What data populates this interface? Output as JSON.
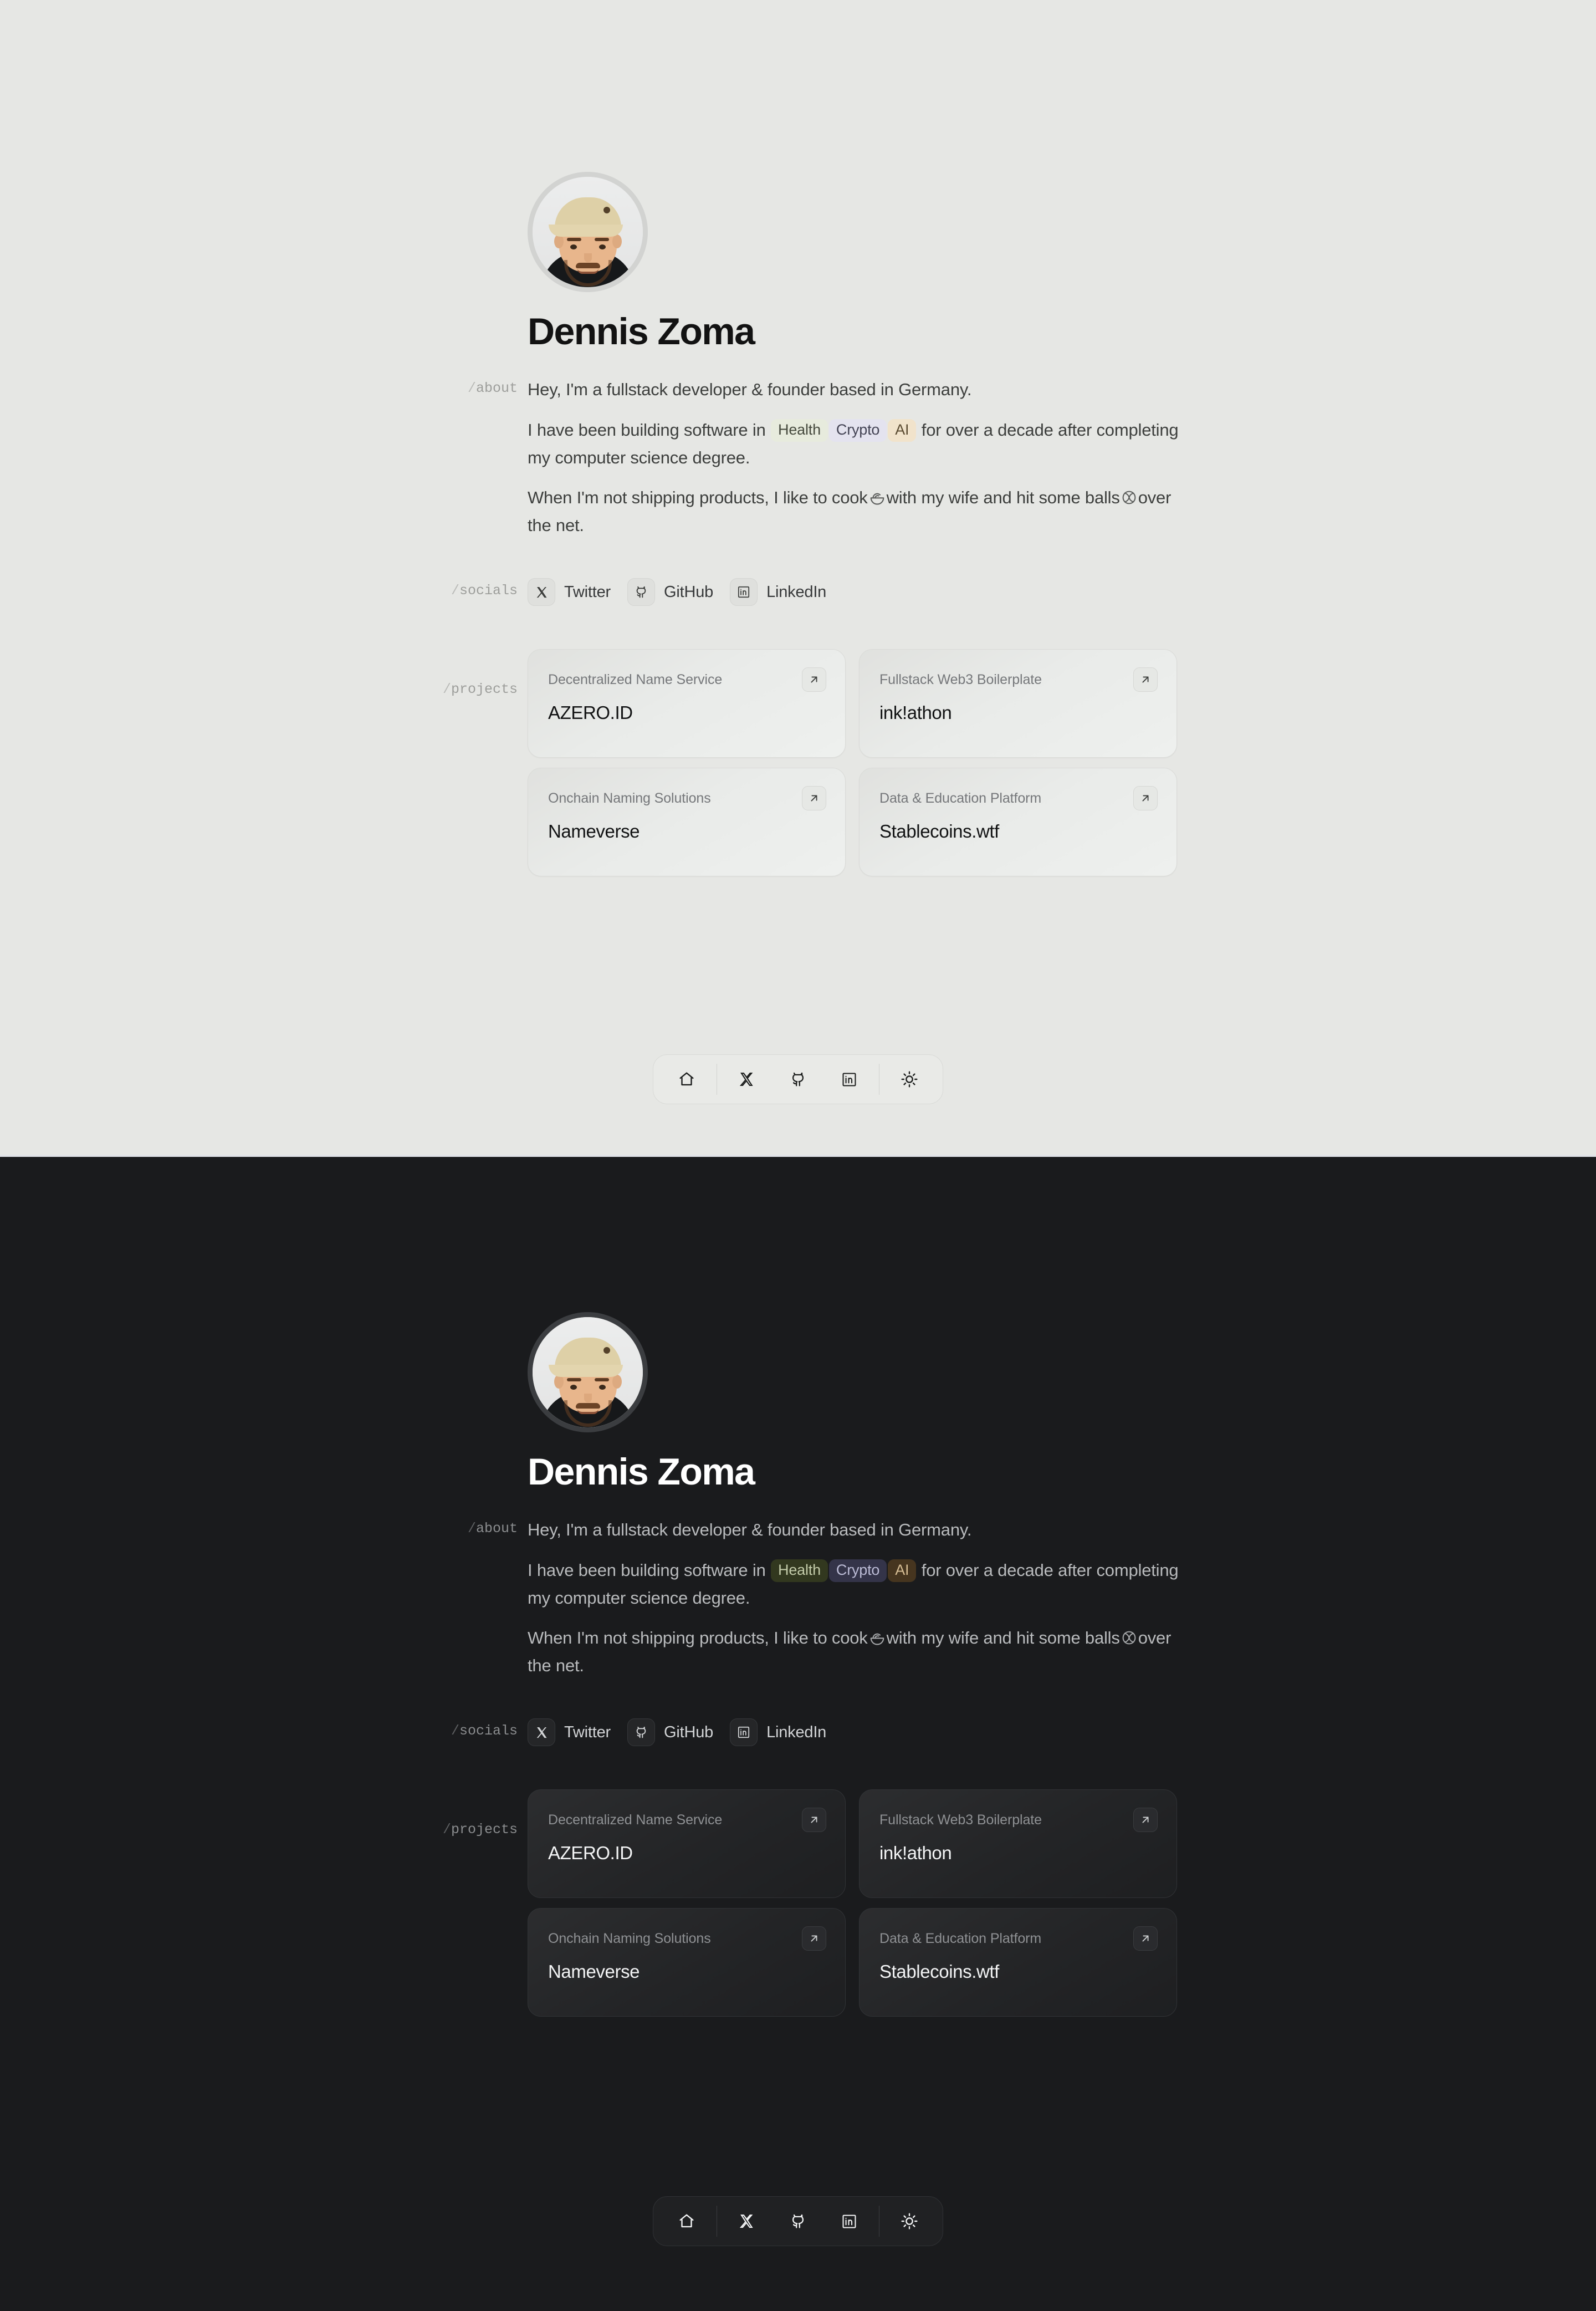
{
  "profile": {
    "name": "Dennis Zoma",
    "avatar_alt": "portrait-photo"
  },
  "sections": {
    "about_label": "/about",
    "socials_label": "/socials",
    "projects_label": "/projects"
  },
  "about": {
    "line1": "Hey, I'm a fullstack developer & founder based in Germany.",
    "p2_before": "I have been building software in",
    "p2_after": "for over a decade after completing my computer science degree.",
    "tags": [
      {
        "label": "Health",
        "key": "health",
        "color": "#e7ebdd"
      },
      {
        "label": "Crypto",
        "key": "crypto",
        "color": "#e4e3ef"
      },
      {
        "label": "AI",
        "key": "ai",
        "color": "#f1e3cb"
      }
    ],
    "p3_before": "When I'm not shipping products, I like to cook",
    "p3_middle": "with my wife and hit some balls",
    "p3_after": "over the net.",
    "cook_icon": "bowl-icon",
    "tennis_icon": "tennis-ball-icon"
  },
  "socials": [
    {
      "name": "Twitter",
      "icon": "x-icon"
    },
    {
      "name": "GitHub",
      "icon": "github-icon"
    },
    {
      "name": "LinkedIn",
      "icon": "linkedin-icon"
    }
  ],
  "projects": [
    {
      "subtitle": "Decentralized Name Service",
      "title": "AZERO.ID",
      "link_icon": "arrow-up-right-icon"
    },
    {
      "subtitle": "Fullstack Web3 Boilerplate",
      "title": "ink!athon",
      "link_icon": "arrow-up-right-icon"
    },
    {
      "subtitle": "Onchain Naming Solutions",
      "title": "Nameverse",
      "link_icon": "arrow-up-right-icon"
    },
    {
      "subtitle": "Data & Education Platform",
      "title": "Stablecoins.wtf",
      "link_icon": "arrow-up-right-icon"
    }
  ],
  "dock": [
    {
      "name": "Home",
      "icon": "home-icon"
    },
    {
      "name": "Twitter",
      "icon": "x-icon"
    },
    {
      "name": "GitHub",
      "icon": "github-icon"
    },
    {
      "name": "LinkedIn",
      "icon": "linkedin-icon"
    },
    {
      "name": "Toggle theme",
      "icon": "sun-icon"
    }
  ],
  "themes": {
    "light_bg": "#e6e7e4",
    "dark_bg": "#1a1b1d",
    "light_text": "#121212",
    "dark_text": "#ffffff"
  }
}
